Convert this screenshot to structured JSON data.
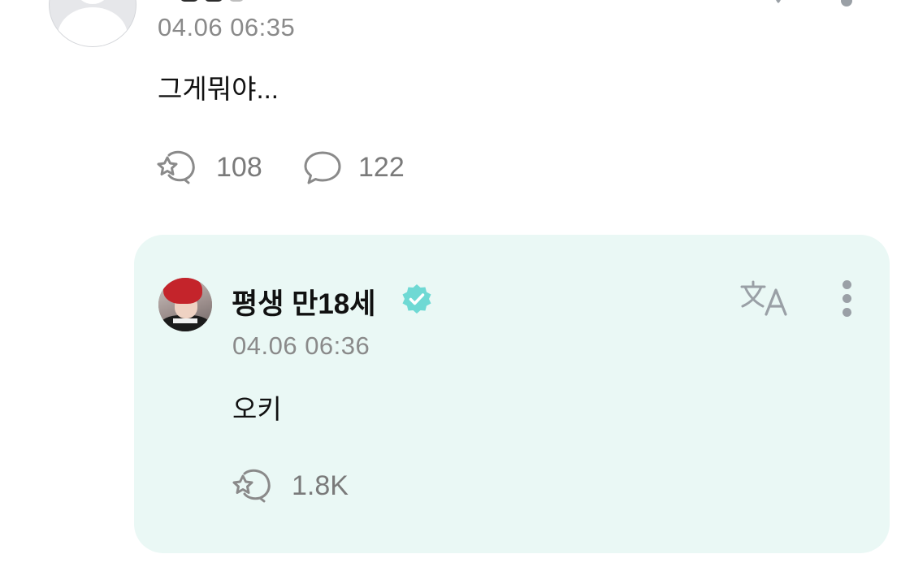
{
  "parent_comment": {
    "timestamp": "04.06 06:35",
    "text": "그게뭐야...",
    "like_icon": "star-reaction-icon",
    "like_count": "108",
    "reply_icon": "speech-bubble-icon",
    "reply_count": "122"
  },
  "reply": {
    "author_name": "평생 만18세",
    "verified": true,
    "verified_color": "#6fd9d4",
    "timestamp": "04.06 06:36",
    "text": "오키",
    "like_icon": "star-reaction-icon",
    "like_count": "1.8K",
    "card_background": "#eaf8f5"
  },
  "icons": {
    "translate": "translate-icon",
    "more": "more-vertical-icon"
  }
}
